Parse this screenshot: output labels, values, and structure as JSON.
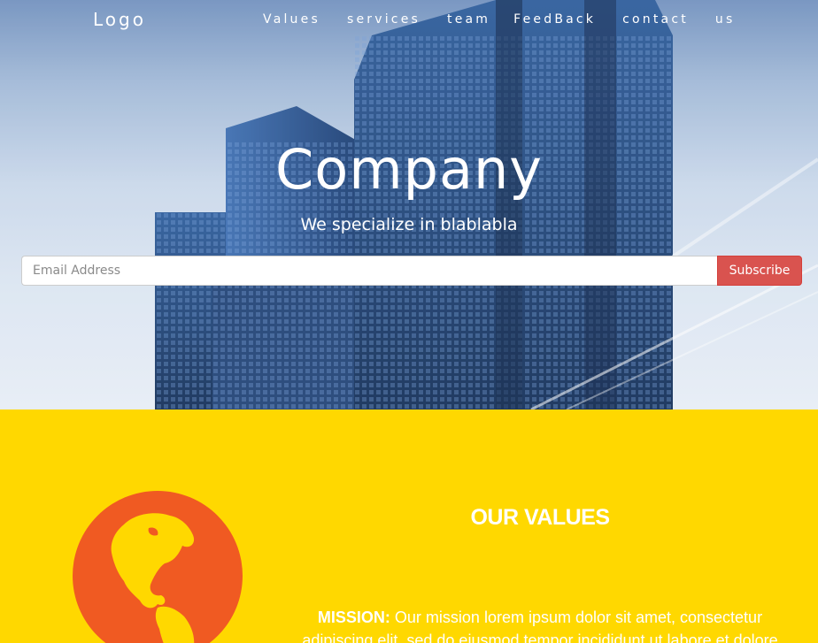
{
  "nav": {
    "logo": "Logo",
    "links": [
      {
        "label": "Values"
      },
      {
        "label": "services"
      },
      {
        "label": "team"
      },
      {
        "label": "FeedBack"
      },
      {
        "label": "contact"
      },
      {
        "label": "us"
      }
    ]
  },
  "hero": {
    "title": "Company",
    "subtitle": "We specialize in blablabla",
    "email_placeholder": "Email Address",
    "email_value": "",
    "subscribe_label": "Subscribe"
  },
  "values": {
    "title": "OUR VALUES",
    "mission_label": "MISSION:",
    "mission_text": " Our mission lorem ipsum dolor sit amet, consectetur adipiscing elit, sed do eiusmod tempor incididunt ut labore et dolore magna aliqua. Ut enim ad minim veniam, quis nostrud",
    "globe_icon": "globe-americas-icon"
  },
  "colors": {
    "accent_yellow": "#ffd800",
    "globe_orange": "#f05a22",
    "subscribe_red": "#d9534f"
  }
}
